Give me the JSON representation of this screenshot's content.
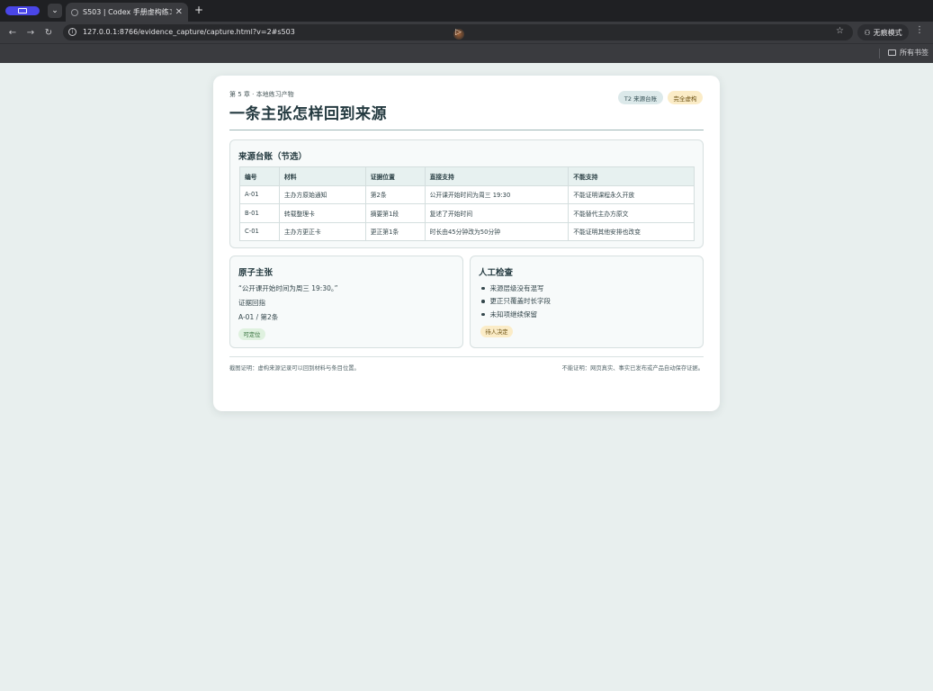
{
  "browser": {
    "tab_title": "S503 | Codex 手册虚构练习产",
    "tab_close": "✕",
    "new_tab": "+",
    "url": "127.0.0.1:8766/evidence_capture/capture.html?v=2#s503",
    "incognito_label": "无痕模式",
    "all_bookmarks": "所有书签"
  },
  "header": {
    "kicker": "第 5 章 · 本地练习产物",
    "title": "一条主张怎样回到来源",
    "badges": [
      "T2 来源台账",
      "完全虚构"
    ]
  },
  "ledger": {
    "title": "来源台账（节选）",
    "columns": [
      "编号",
      "材料",
      "证据位置",
      "直接支持",
      "不能支持"
    ],
    "rows": [
      [
        "A-01",
        "主办方原始通知",
        "第2条",
        "公开课开始时间为周三 19:30",
        "不能证明课程永久开放"
      ],
      [
        "B-01",
        "转载整理卡",
        "摘要第1段",
        "复述了开始时间",
        "不能替代主办方原文"
      ],
      [
        "C-01",
        "主办方更正卡",
        "更正第1条",
        "时长由45分钟改为50分钟",
        "不能证明其他安排也改变"
      ]
    ]
  },
  "claim": {
    "title": "原子主张",
    "quote": "“公开课开始时间为周三 19:30。”",
    "evidence_label": "证据回指",
    "evidence_ref": "A-01 / 第2条",
    "chip": "可定位"
  },
  "check": {
    "title": "人工检查",
    "items": [
      "来源层级没有混写",
      "更正只覆盖时长字段",
      "未知项继续保留"
    ],
    "chip": "待人决定"
  },
  "footer": {
    "left": "截图证明：虚构来源记录可以回到材料与条目位置。",
    "right": "不能证明：网页真实、事实已发布或产品自动保存证据。"
  }
}
